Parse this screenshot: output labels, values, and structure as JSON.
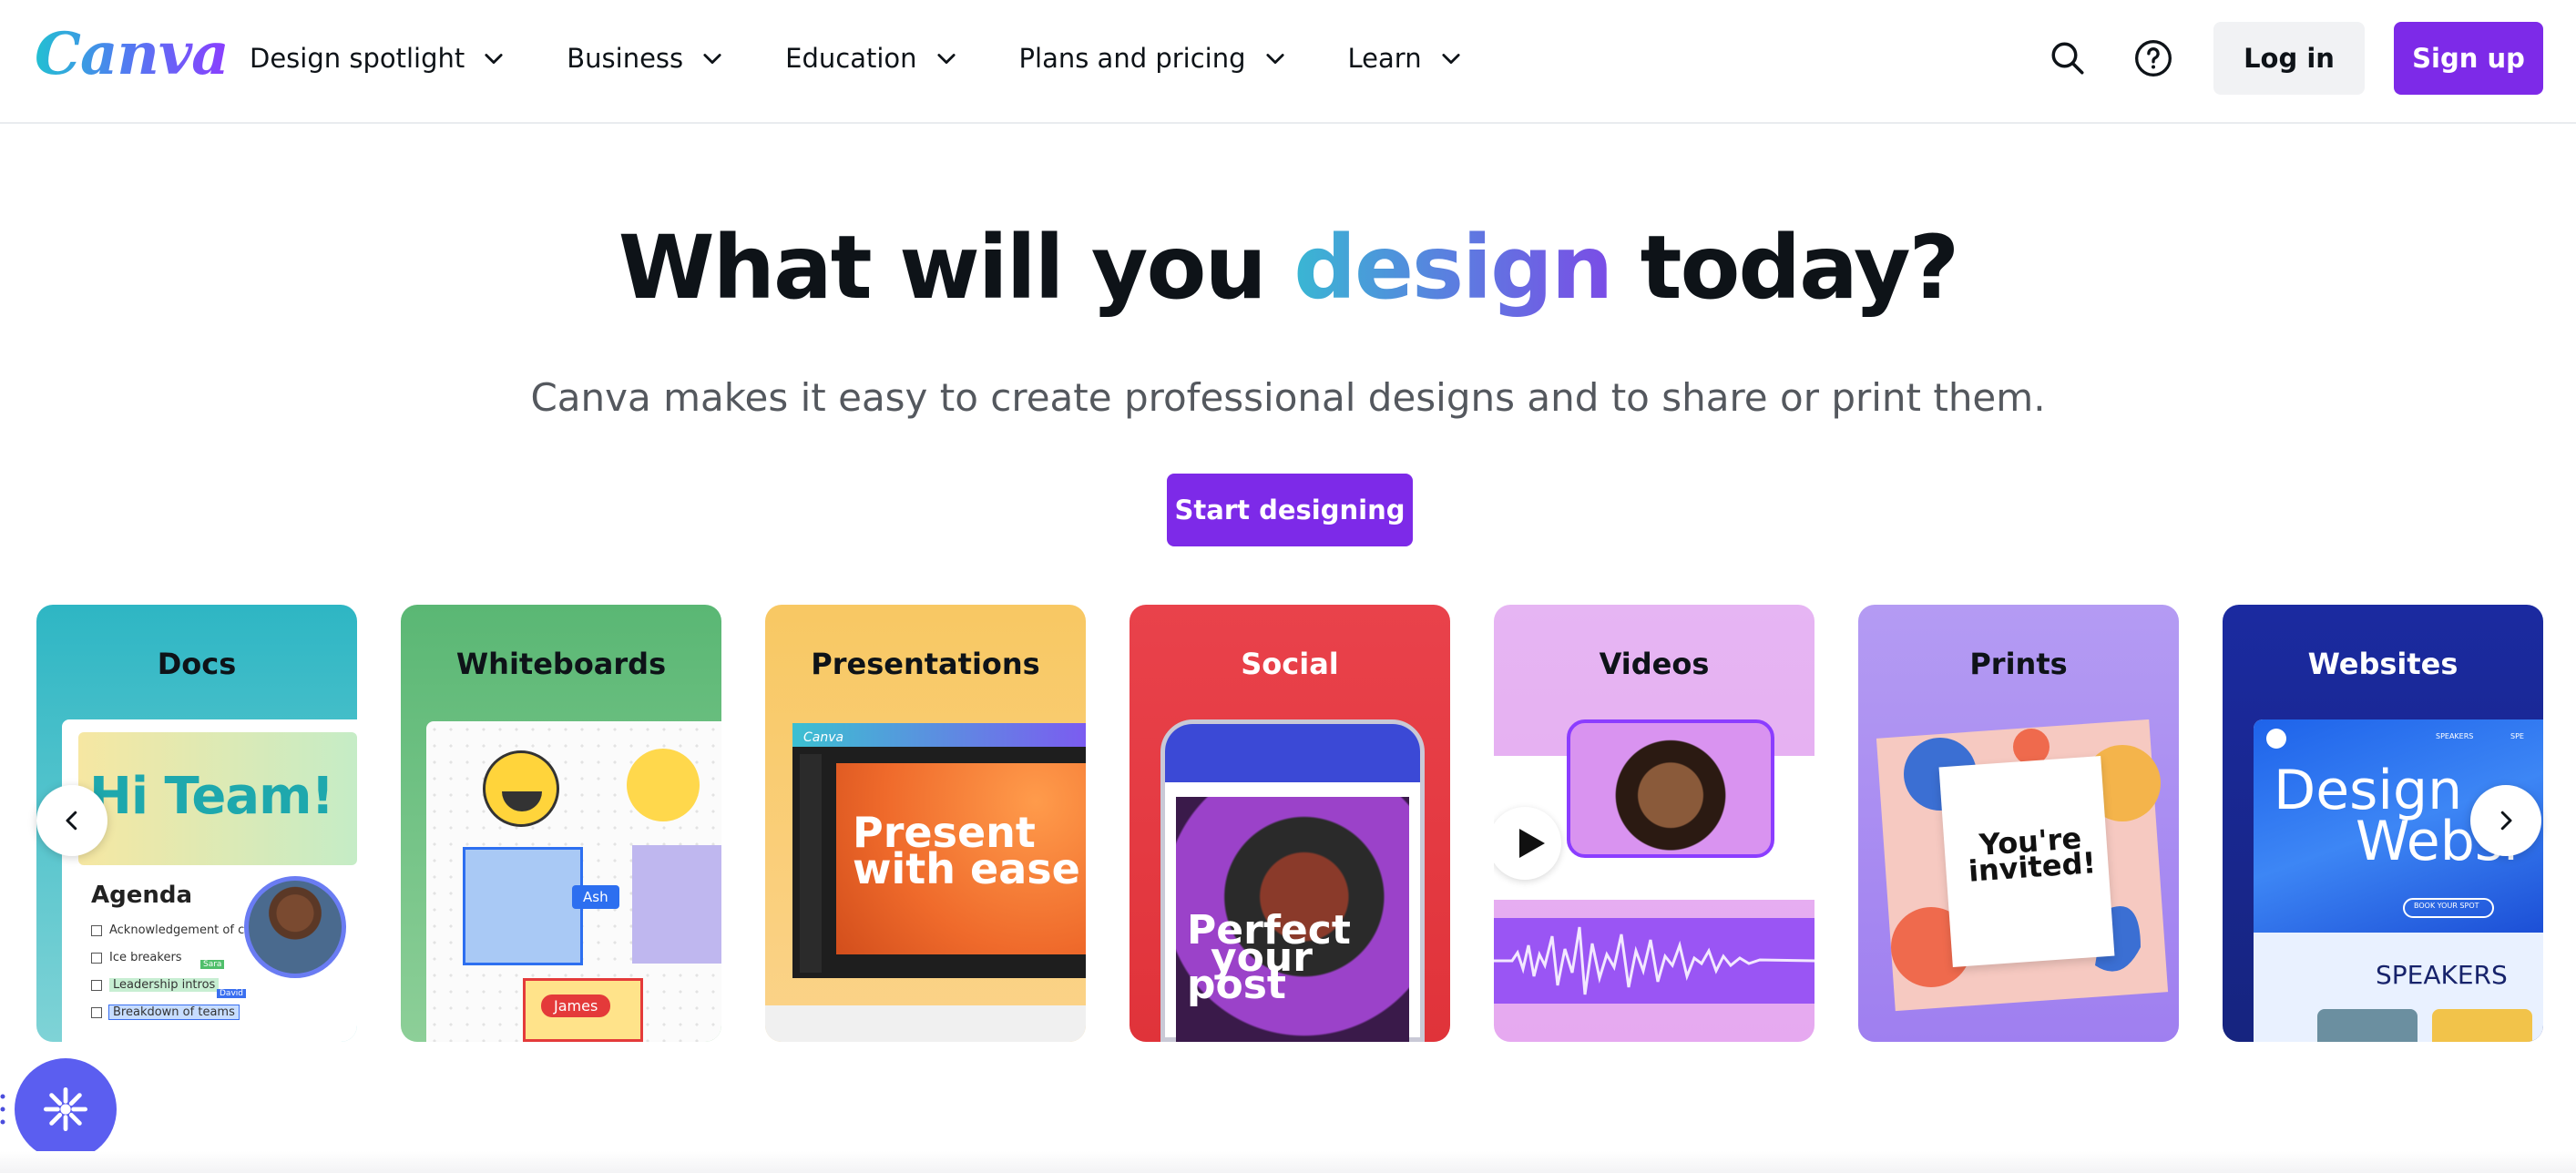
{
  "nav": {
    "logo": "Canva",
    "menu": [
      {
        "label": "Design spotlight"
      },
      {
        "label": "Business"
      },
      {
        "label": "Education"
      },
      {
        "label": "Plans and pricing"
      },
      {
        "label": "Learn"
      }
    ],
    "login_label": "Log in",
    "signup_label": "Sign up",
    "icons": {
      "search": "search-icon",
      "help": "help-icon",
      "chevron": "chevron-down-icon"
    }
  },
  "hero": {
    "title_pre": "What will you ",
    "title_accent": "design",
    "title_post": " today?",
    "subtitle": "Canva makes it easy to create professional designs and to share or print them.",
    "cta_label": "Start designing"
  },
  "categories": [
    {
      "label": "Docs",
      "color": "#2eb6c4"
    },
    {
      "label": "Whiteboards",
      "color": "#5ab774"
    },
    {
      "label": "Presentations",
      "color": "#f8c863"
    },
    {
      "label": "Social",
      "color": "#e9424b"
    },
    {
      "label": "Videos",
      "color": "#e6b5f3"
    },
    {
      "label": "Prints",
      "color": "#b49bf3"
    },
    {
      "label": "Websites",
      "color": "#1b2aa0"
    }
  ],
  "previews": {
    "docs": {
      "banner": "Hi Team!",
      "heading": "Agenda",
      "items": [
        "Acknowledgement of cou",
        "Ice breakers",
        "Leadership intros",
        "Breakdown of teams"
      ],
      "tag1": "Sara",
      "tag2": "David"
    },
    "whiteboards": {
      "tag_ash": "Ash",
      "tag_james": "James"
    },
    "presentations": {
      "brand": "Canva",
      "slide_line1": "Present",
      "slide_line2": "with ease"
    },
    "social": {
      "post_line1": "Perfect",
      "post_line2": "your",
      "post_line3": "post"
    },
    "prints": {
      "line1": "You're",
      "line2": "invited!"
    },
    "websites": {
      "line1": "Design",
      "line2": "Websi",
      "section": "SPEAKERS",
      "button": "BOOK YOUR SPOT",
      "menu1": "SPEAKERS",
      "menu2": "SPE"
    }
  },
  "colors": {
    "brand_purple": "#7d2ae8",
    "text": "#0e1318",
    "subtle": "#54585e"
  }
}
